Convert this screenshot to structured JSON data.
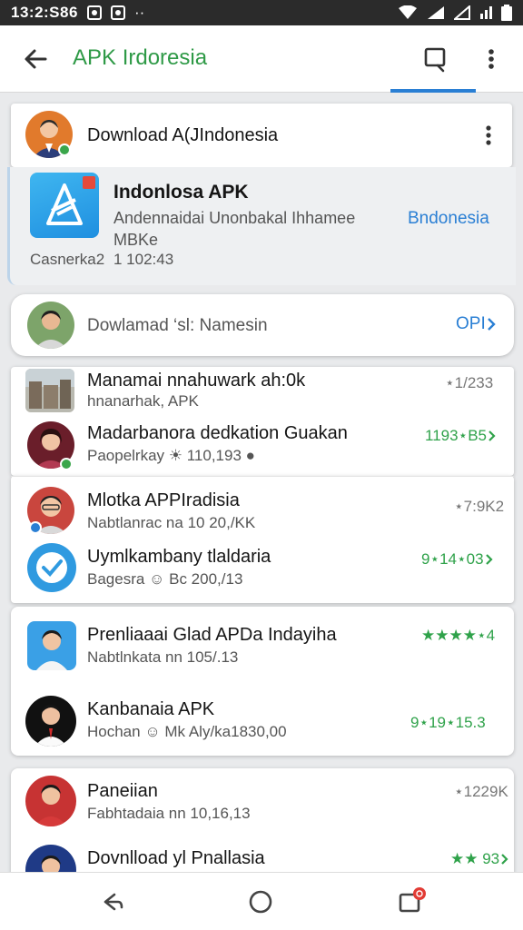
{
  "status_bar": {
    "time": "13:2:S86",
    "dots": "··"
  },
  "app_bar": {
    "title": "APK Irdoresia"
  },
  "header_card": {
    "title": "Download A(JIndonesia"
  },
  "featured": {
    "app_name": "Indonlosa APK",
    "description": "Andennaidai Unonbakal Ihhamee",
    "extra": "MBKe",
    "meta_label": "Casnerka2",
    "meta_value": "1 102:43",
    "link": "Bndonesia"
  },
  "download_row": {
    "label": "Dowlamad ‘sl: Namesin",
    "action": "OPI"
  },
  "group1": [
    {
      "name": "Manamai nnahuwark ah:0k",
      "sub": "hnanarhak, APK",
      "rating": "⋆1/233",
      "rating_green": false
    },
    {
      "name": "Madarbanora dedkation Guakan",
      "sub": "Paopelrkay ☀ 110,193 ●",
      "rating": "1193⋆B5",
      "rating_green": true
    }
  ],
  "group2": [
    {
      "name": "Mlotka APPIradisia",
      "sub": "Nabtlanrac na 10 20,/KK",
      "rating": "⋆7:9K2",
      "rating_green": false
    },
    {
      "name": "Uymlkambany tlaldaria",
      "sub": "Bagesra ☺ Bc 200,/13",
      "rating": "9⋆14⋆03",
      "rating_green": true
    }
  ],
  "group3": [
    {
      "name": "Prenliaaai Glad APDa Indayiha",
      "sub": "Nabtlnkata nn 105/.13",
      "rating": "★★★★⋆4",
      "rating_green": true
    },
    {
      "name": "Kanbanaia APK",
      "sub": "Hochan ☺ Mk Aly/ka1830,00",
      "rating": "9⋆19⋆15.3",
      "rating_green": true
    }
  ],
  "group4": [
    {
      "name": "Paneiian",
      "sub": "Fabhtadaia nn 10,16,13",
      "rating": "⋆1229K",
      "rating_green": false
    },
    {
      "name": "Dovnlload yl Pnallasia",
      "sub": "",
      "rating": "★★ 93",
      "rating_green": true
    }
  ],
  "colors": {
    "accent_green": "#2f9a47",
    "accent_blue": "#2a7fd4",
    "rating_green": "#2fa24a"
  }
}
